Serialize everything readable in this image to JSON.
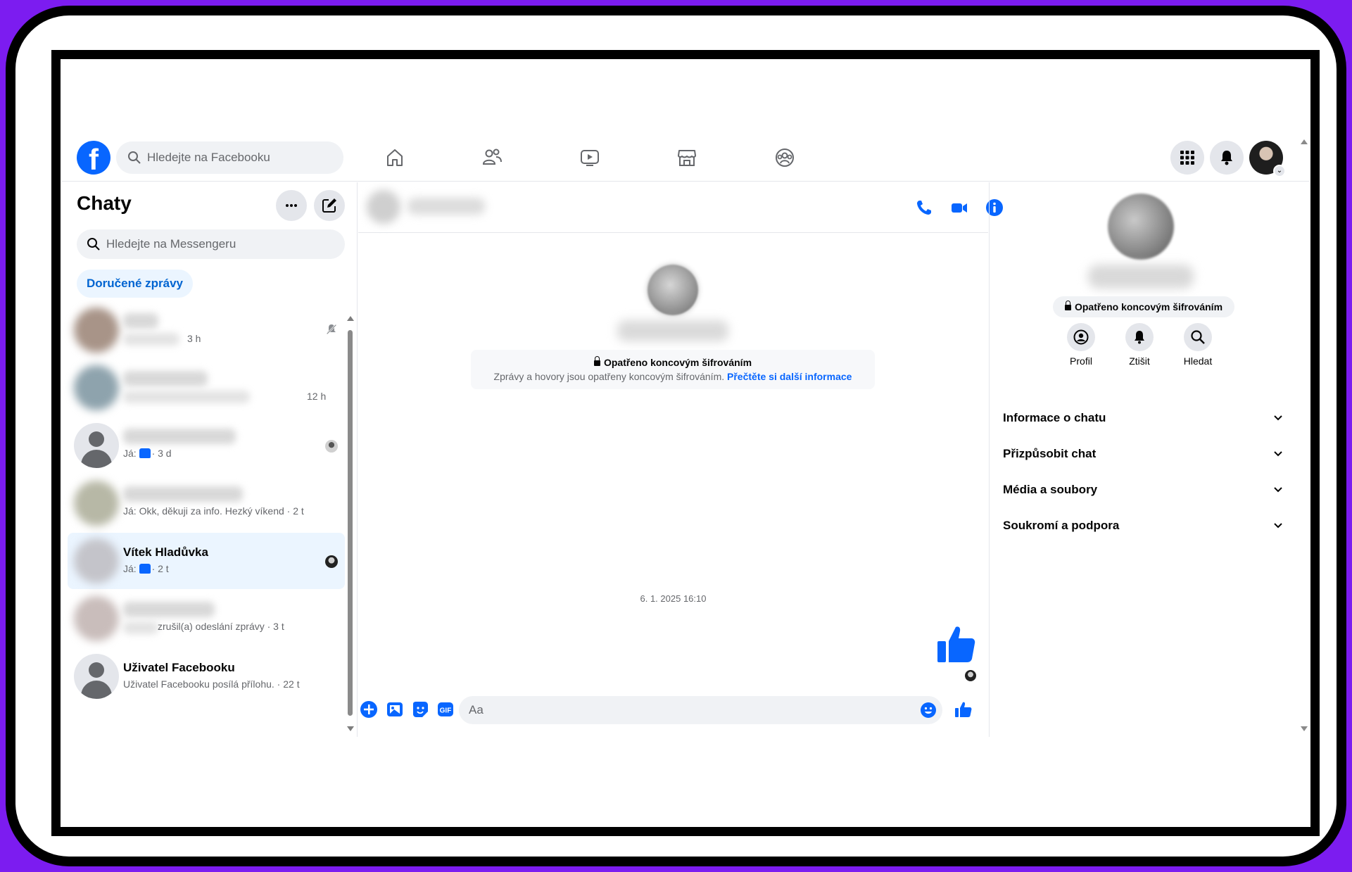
{
  "topbar": {
    "search_placeholder": "Hledejte na Facebooku",
    "nav_icons": [
      "home-icon",
      "friends-icon",
      "video-icon",
      "marketplace-icon",
      "groups-icon"
    ],
    "right_icons": [
      "menu-grid-icon",
      "notifications-bell-icon",
      "account-avatar"
    ]
  },
  "chats": {
    "title": "Chaty",
    "search_placeholder": "Hledejte na Messengeru",
    "filter_label": "Doručené zprávy",
    "conversations": [
      {
        "time": "3 h",
        "status_icon": "muted-bell-icon"
      },
      {
        "time": "12 h"
      },
      {
        "sub": "Já:",
        "time_text": "· 3 d",
        "status_icon": "seen-avatar"
      },
      {
        "sub": "Já: Okk, děkuji za info. Hezký víkend · 2 t"
      },
      {
        "name": "Vítek Hladůvka",
        "sub": "Já:",
        "time_text": "· 2 t",
        "status_icon": "seen-avatar",
        "active": true
      },
      {
        "sub": "zrušil(a) odeslání zprávy · 3 t"
      },
      {
        "name": "Uživatel Facebooku",
        "sub": "Uživatel Facebooku posílá přílohu. · 22 t"
      }
    ]
  },
  "chat": {
    "e2e_title": "Opatřeno koncovým šifrováním",
    "e2e_text": "Zprávy a hovory jsou opatřeny koncovým šifrováním.",
    "e2e_link": "Přečtěte si další informace",
    "timestamp": "6. 1. 2025 16:10",
    "composer_placeholder": "Aa",
    "header_icons": [
      "phone-icon",
      "video-call-icon",
      "info-icon"
    ],
    "composer_icons": [
      "plus-icon",
      "photo-icon",
      "sticker-icon",
      "gif-icon"
    ]
  },
  "details": {
    "e2e_badge": "Opatřeno koncovým šifrováním",
    "actions": [
      {
        "label": "Profil",
        "icon": "profile-icon"
      },
      {
        "label": "Ztišit",
        "icon": "bell-icon"
      },
      {
        "label": "Hledat",
        "icon": "search-icon"
      }
    ],
    "sections": [
      "Informace o chatu",
      "Přizpůsobit chat",
      "Média a soubory",
      "Soukromí a podpora"
    ]
  },
  "colors": {
    "accent": "#0866ff",
    "frame": "#7c1cf0",
    "active_row": "#ebf5ff"
  }
}
